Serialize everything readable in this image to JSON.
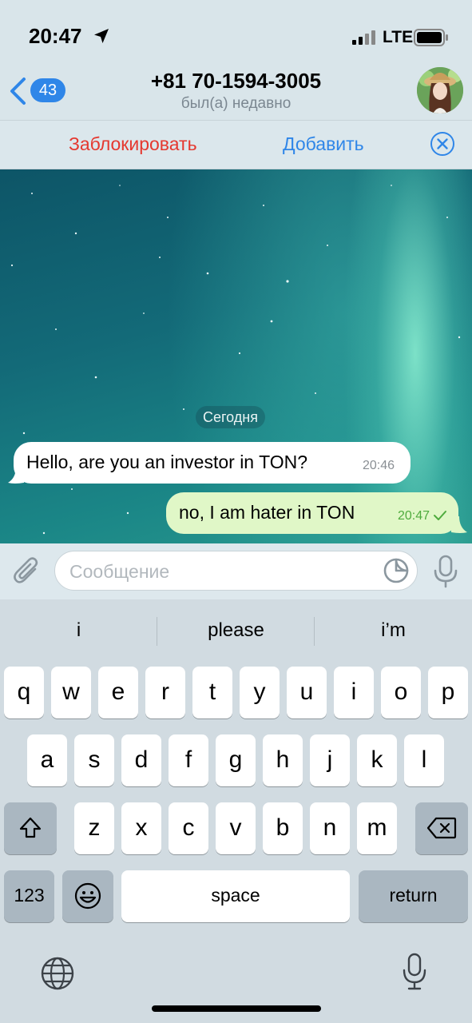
{
  "status_bar": {
    "time": "20:47",
    "network": "LTE",
    "icons": [
      "location-arrow-icon",
      "signal-icon",
      "battery-icon"
    ]
  },
  "header": {
    "back_count": "43",
    "title": "+81 70-1594-3005",
    "subtitle": "был(а) недавно",
    "avatar_icon": "avatar"
  },
  "action_bar": {
    "block_label": "Заблокировать",
    "add_label": "Добавить",
    "close_icon": "close-circle-icon"
  },
  "chat": {
    "date_label": "Сегодня",
    "messages": [
      {
        "direction": "incoming",
        "text": "Hello, are you an investor in TON?",
        "time": "20:46"
      },
      {
        "direction": "outgoing",
        "text": "no, I am hater in TON",
        "time": "20:47",
        "status": "sent-check"
      }
    ]
  },
  "composer": {
    "placeholder": "Сообщение",
    "value": "",
    "icons": [
      "paperclip-icon",
      "sticker-icon",
      "microphone-icon"
    ]
  },
  "keyboard": {
    "suggestions": [
      "i",
      "please",
      "i’m"
    ],
    "rows": [
      [
        "q",
        "w",
        "e",
        "r",
        "t",
        "y",
        "u",
        "i",
        "o",
        "p"
      ],
      [
        "a",
        "s",
        "d",
        "f",
        "g",
        "h",
        "j",
        "k",
        "l"
      ],
      [
        "z",
        "x",
        "c",
        "v",
        "b",
        "n",
        "m"
      ]
    ],
    "numbers_label": "123",
    "space_label": "space",
    "return_label": "return",
    "icons": [
      "shift-icon",
      "backspace-icon",
      "emoji-icon",
      "globe-icon",
      "dictation-mic-icon"
    ]
  },
  "colors": {
    "accent": "#2f86e8",
    "danger": "#e5382f",
    "outgoing_bubble": "#e0f7c7",
    "time_out": "#4eab3d"
  }
}
